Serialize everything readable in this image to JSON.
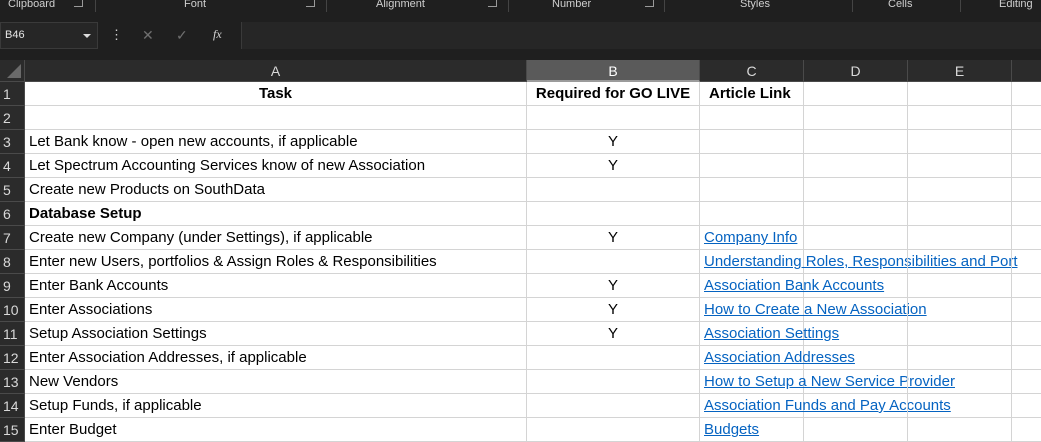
{
  "ribbon": {
    "groups": [
      "Clipboard",
      "Font",
      "Alignment",
      "Number",
      "Styles",
      "Cells",
      "Editing"
    ]
  },
  "formula_bar": {
    "name_box": "B46",
    "formula": ""
  },
  "columns": [
    "A",
    "B",
    "C",
    "D",
    "E"
  ],
  "selected_column": "B",
  "rows": [
    {
      "num": "1",
      "task": "Task",
      "required": "Required for GO LIVE",
      "link": "Article Link",
      "type": "header"
    },
    {
      "num": "2",
      "task": "",
      "required": "",
      "link": ""
    },
    {
      "num": "3",
      "task": "Let Bank know - open new accounts, if applicable",
      "required": "Y",
      "link": ""
    },
    {
      "num": "4",
      "task": "Let Spectrum Accounting Services know of new Association",
      "required": "Y",
      "link": ""
    },
    {
      "num": "5",
      "task": "Create new Products on SouthData",
      "required": "",
      "link": ""
    },
    {
      "num": "6",
      "task": "Database Setup",
      "required": "",
      "link": "",
      "type": "bold"
    },
    {
      "num": "7",
      "task": "Create new Company (under Settings), if applicable",
      "required": "Y",
      "link": "Company Info"
    },
    {
      "num": "8",
      "task": "Enter new Users, portfolios & Assign Roles & Responsibilities",
      "required": "",
      "link": "Understanding Roles, Responsibilities and Port"
    },
    {
      "num": "9",
      "task": "Enter Bank Accounts",
      "required": "Y",
      "link": "Association Bank Accounts"
    },
    {
      "num": "10",
      "task": "Enter Associations",
      "required": "Y",
      "link": "How to Create a New Association"
    },
    {
      "num": "11",
      "task": "Setup Association Settings",
      "required": "Y",
      "link": "Association Settings"
    },
    {
      "num": "12",
      "task": "Enter Association Addresses, if applicable",
      "required": "",
      "link": "Association Addresses"
    },
    {
      "num": "13",
      "task": "New Vendors",
      "required": "",
      "link": "How to Setup a New Service Provider"
    },
    {
      "num": "14",
      "task": "Setup Funds, if applicable",
      "required": "",
      "link": "Association Funds and Pay Accounts"
    },
    {
      "num": "15",
      "task": "Enter Budget",
      "required": "",
      "link": "Budgets"
    }
  ],
  "colors": {
    "chrome": "#1f1f1f",
    "header_bg": "#2b2b2b",
    "selected_header": "#5a5a5a",
    "link": "#0563c1",
    "gridline": "#d4d4d4"
  }
}
